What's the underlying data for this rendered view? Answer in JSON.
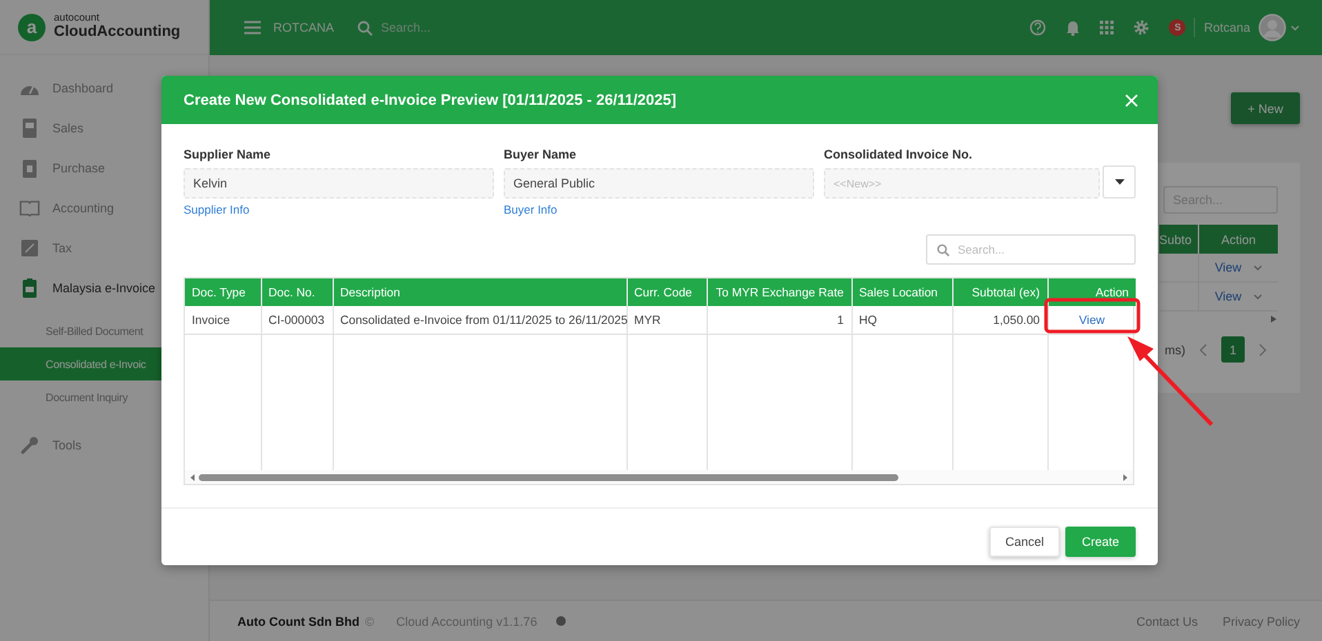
{
  "app": {
    "logo": {
      "mark": "a",
      "brand": "autocount",
      "product": "CloudAccounting"
    },
    "topbar": {
      "company": "ROTCANA",
      "search_placeholder": "Search...",
      "badge": "S",
      "user": "Rotcana"
    },
    "sidebar": {
      "items": [
        {
          "label": "Dashboard",
          "active": false
        },
        {
          "label": "Sales",
          "active": false
        },
        {
          "label": "Purchase",
          "active": false
        },
        {
          "label": "Accounting",
          "active": false
        },
        {
          "label": "Tax",
          "active": false
        },
        {
          "label": "Malaysia e-Invoice",
          "active": true,
          "children": [
            {
              "label": "Self-Billed Document",
              "selected": false
            },
            {
              "label": "Consolidated e-Invoic",
              "selected": true
            },
            {
              "label": "Document Inquiry",
              "selected": false
            }
          ]
        },
        {
          "label": "Tools",
          "active": false
        }
      ]
    },
    "new_button": "+ New",
    "list": {
      "search_placeholder": "Search...",
      "columns": [
        "Subto",
        "Action"
      ],
      "rows": [
        {
          "action": "View"
        },
        {
          "action": "View"
        }
      ],
      "pagination": {
        "summary": "ms)",
        "pages": [
          {
            "label": "1",
            "selected": true
          }
        ]
      }
    },
    "footer": {
      "company": "Auto Count Sdn Bhd",
      "copyright": "©",
      "version": "Cloud Accounting v1.1.76",
      "links": [
        "Contact Us",
        "Privacy Policy"
      ]
    }
  },
  "modal": {
    "title": "Create New Consolidated e-Invoice Preview [01/11/2025 - 26/11/2025]",
    "fields": [
      {
        "kind": "text",
        "label": "Supplier Name",
        "value": "Kelvin",
        "link": "Supplier Info"
      },
      {
        "kind": "text",
        "label": "Buyer Name",
        "value": "General Public",
        "link": "Buyer Info"
      },
      {
        "kind": "dropdown",
        "label": "Consolidated Invoice No.",
        "placeholder": "<<New>>"
      }
    ],
    "search": {
      "placeholder": "Search..."
    },
    "table": {
      "columns": [
        {
          "label": "Doc. Type",
          "kind": "text"
        },
        {
          "label": "Doc. No.",
          "kind": "text"
        },
        {
          "label": "Description",
          "kind": "text"
        },
        {
          "label": "Curr. Code",
          "kind": "text"
        },
        {
          "label": "To MYR Exchange Rate",
          "kind": "number"
        },
        {
          "label": "Sales Location",
          "kind": "text"
        },
        {
          "label": "Subtotal (ex)",
          "kind": "number"
        },
        {
          "label": "Action",
          "kind": "action"
        }
      ],
      "rows": [
        [
          "Invoice",
          "CI-000003",
          "Consolidated e-Invoice from 01/11/2025 to 26/11/2025",
          "MYR",
          "1",
          "HQ",
          "1,050.00",
          "View"
        ]
      ]
    },
    "buttons": [
      {
        "label": "Cancel",
        "kind": "secondary"
      },
      {
        "label": "Create",
        "kind": "primary"
      }
    ]
  },
  "annotations": [
    {
      "kind": "highlight-box"
    },
    {
      "kind": "arrow"
    }
  ]
}
